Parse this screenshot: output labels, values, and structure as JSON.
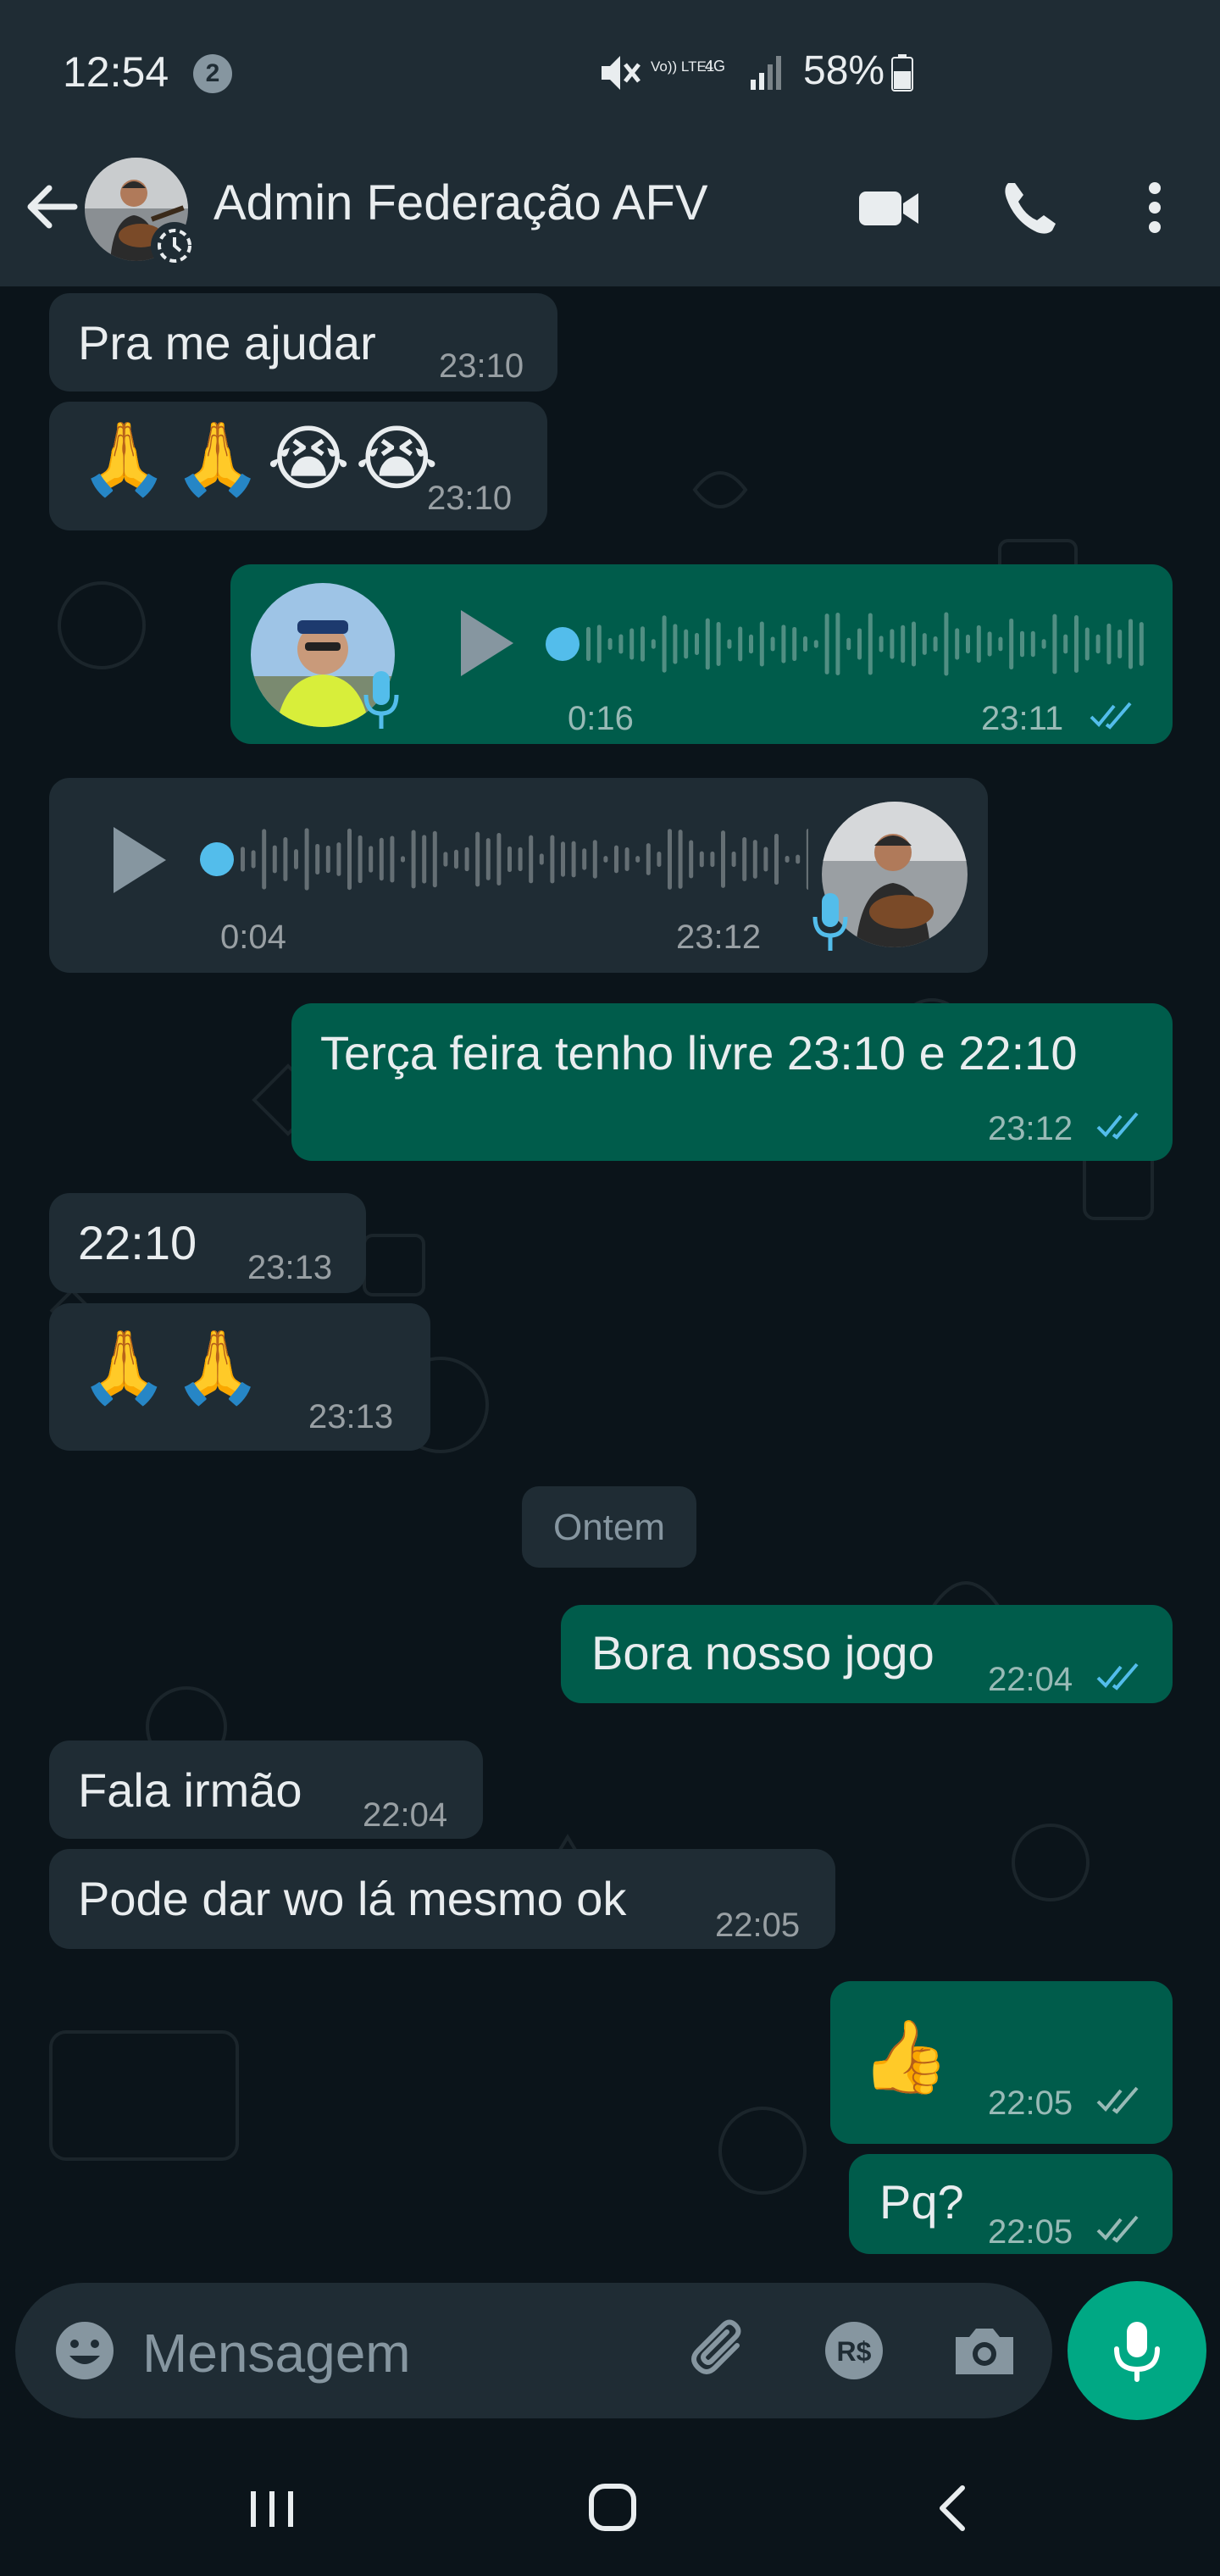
{
  "status_bar": {
    "time": "12:54",
    "notification_count": "2",
    "network_label": "Vo)) LTE1",
    "network_type": "4G",
    "battery": "58%"
  },
  "header": {
    "contact_name": "Admin Federação AFV"
  },
  "messages": [
    {
      "dir": "in",
      "type": "text",
      "text": "Pra me ajudar",
      "time": "23:10"
    },
    {
      "dir": "in",
      "type": "emoji",
      "text": "🙏🙏😭😭",
      "time": "23:10"
    },
    {
      "dir": "out",
      "type": "voice",
      "duration": "0:16",
      "time": "23:11",
      "status": "read"
    },
    {
      "dir": "in",
      "type": "voice",
      "duration": "0:04",
      "time": "23:12"
    },
    {
      "dir": "out",
      "type": "text",
      "text": "Terça feira tenho livre 23:10 e 22:10",
      "time": "23:12",
      "status": "read"
    },
    {
      "dir": "in",
      "type": "text",
      "text": "22:10",
      "time": "23:13"
    },
    {
      "dir": "in",
      "type": "emoji",
      "text": "🙏🙏",
      "time": "23:13"
    },
    {
      "dir": "out",
      "type": "text",
      "text": "Bora nosso jogo",
      "time": "22:04",
      "status": "read"
    },
    {
      "dir": "in",
      "type": "text",
      "text": "Fala irmão",
      "time": "22:04"
    },
    {
      "dir": "in",
      "type": "text",
      "text": "Pode dar wo lá mesmo ok",
      "time": "22:05"
    },
    {
      "dir": "out",
      "type": "emoji",
      "text": "👍",
      "time": "22:05",
      "status": "delivered"
    },
    {
      "dir": "out",
      "type": "text",
      "text": "Pq?",
      "time": "22:05",
      "status": "delivered"
    }
  ],
  "date_divider": "Ontem",
  "composer": {
    "placeholder": "Mensagem"
  },
  "colors": {
    "incoming": "#1f2c34",
    "outgoing": "#005c4b",
    "read_tick": "#53bdeb",
    "accent": "#00a884",
    "background": "#0b141a"
  }
}
